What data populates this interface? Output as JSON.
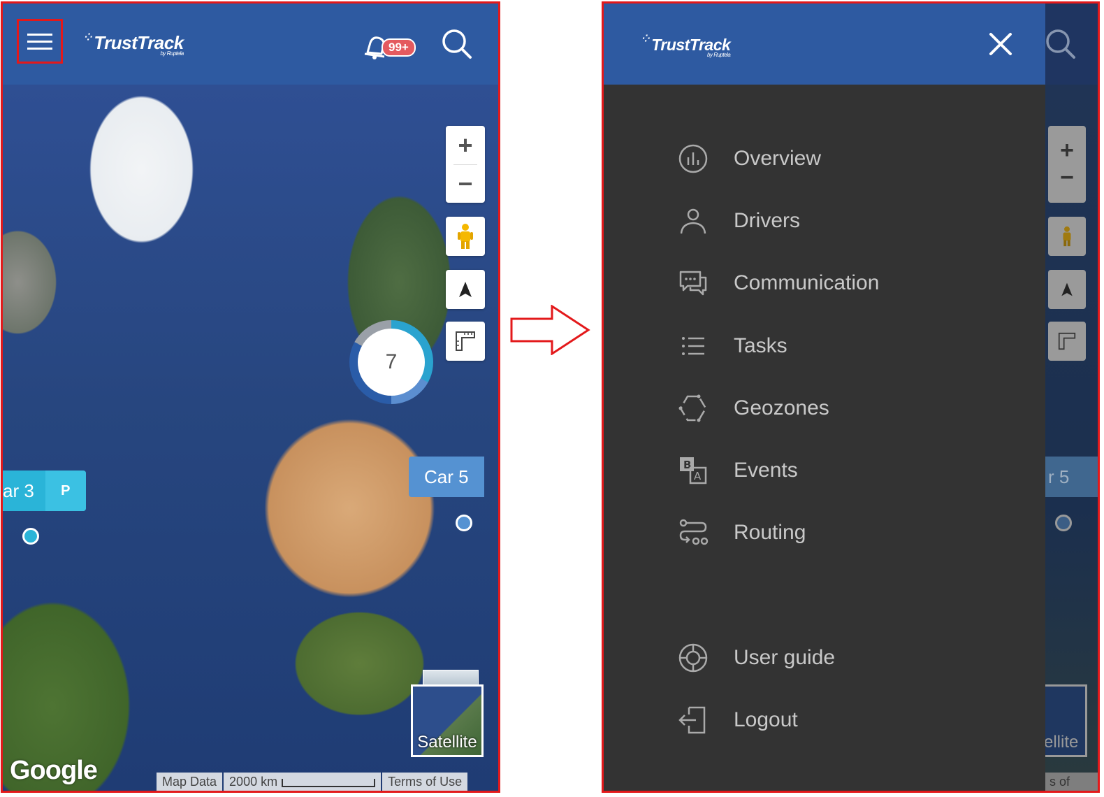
{
  "left": {
    "header": {
      "logo": "TrustTrack",
      "logo_sub": "by Ruptela",
      "notification_badge": "99+"
    },
    "map": {
      "cluster_count": "7",
      "car3_label": "ar 3",
      "car3_status": "P",
      "car5_label": "Car 5",
      "basemap_label": "Satellite",
      "google": "Google",
      "map_data": "Map Data",
      "scale": "2000 km",
      "terms": "Terms of Use"
    }
  },
  "right": {
    "header": {
      "logo": "TrustTrack",
      "logo_sub": "by Ruptela"
    },
    "menu": {
      "items": [
        {
          "label": "Overview",
          "icon": "chart-circle-icon"
        },
        {
          "label": "Drivers",
          "icon": "person-icon"
        },
        {
          "label": "Communication",
          "icon": "chat-icon"
        },
        {
          "label": "Tasks",
          "icon": "list-icon"
        },
        {
          "label": "Geozones",
          "icon": "geozone-icon"
        },
        {
          "label": "Events",
          "icon": "events-icon"
        },
        {
          "label": "Routing",
          "icon": "routing-icon"
        }
      ],
      "footer_items": [
        {
          "label": "User guide",
          "icon": "lifebuoy-icon"
        },
        {
          "label": "Logout",
          "icon": "logout-icon"
        }
      ]
    },
    "background": {
      "car5_partial": "r 5",
      "satellite_partial": "ellite",
      "terms_partial": "s of Use"
    }
  },
  "colors": {
    "header_blue": "#2e5aa1",
    "drawer_gray": "#333333",
    "highlight_red": "#e3191b",
    "car3_cyan": "#2ab4d8",
    "car5_blue": "#5592d2"
  }
}
